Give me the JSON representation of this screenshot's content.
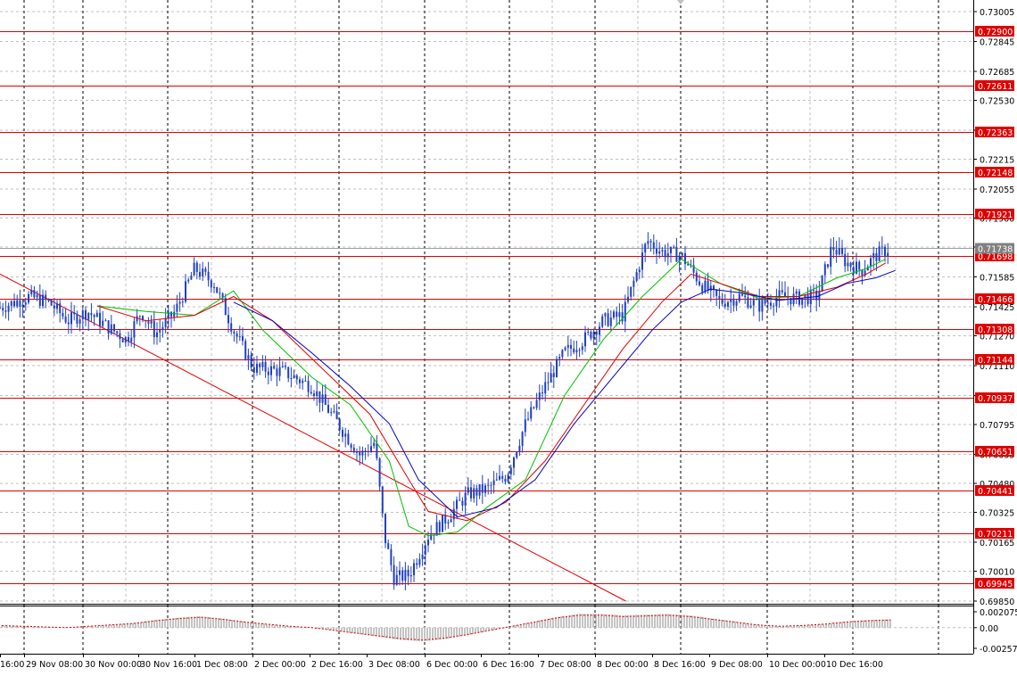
{
  "chart_data": {
    "type": "candlestick",
    "main": {
      "ylim": [
        0.6985,
        0.73005
      ],
      "price_scale_ticks": [
        "0.73005",
        "0.72845",
        "0.72685",
        "0.72530",
        "0.72370",
        "0.72215",
        "0.72055",
        "0.71900",
        "0.71745",
        "0.71585",
        "0.71425",
        "0.71270",
        "0.71110",
        "0.70950",
        "0.70795",
        "0.70635",
        "0.70480",
        "0.70325",
        "0.70165",
        "0.70010",
        "0.69850"
      ],
      "horizontal_levels": [
        0.729,
        0.72611,
        0.72363,
        0.72148,
        0.71921,
        0.71698,
        0.71466,
        0.71308,
        0.71144,
        0.70937,
        0.70651,
        0.70441,
        0.70211,
        0.69945
      ],
      "horizontal_level_labels": [
        "0.72900",
        "0.72611",
        "0.72363",
        "0.72148",
        "0.71921",
        "0.71698",
        "0.71466",
        "0.71308",
        "0.71144",
        "0.70937",
        "0.70651",
        "0.70441",
        "0.70211",
        "0.69945"
      ],
      "current_price_label": "0.71738",
      "current_price": 0.71738,
      "trendline": {
        "from": [
          0,
          0.716
        ],
        "to": [
          0.643,
          0.6985
        ]
      },
      "price_path": [
        [
          0.0,
          0.7142
        ],
        [
          0.03,
          0.7148
        ],
        [
          0.05,
          0.7145
        ],
        [
          0.07,
          0.7135
        ],
        [
          0.09,
          0.714
        ],
        [
          0.11,
          0.7132
        ],
        [
          0.13,
          0.7125
        ],
        [
          0.145,
          0.714
        ],
        [
          0.16,
          0.7128
        ],
        [
          0.18,
          0.714
        ],
        [
          0.2,
          0.7163
        ],
        [
          0.22,
          0.7155
        ],
        [
          0.24,
          0.713
        ],
        [
          0.26,
          0.711
        ],
        [
          0.29,
          0.7108
        ],
        [
          0.32,
          0.71
        ],
        [
          0.35,
          0.7078
        ],
        [
          0.37,
          0.7063
        ],
        [
          0.385,
          0.707
        ],
        [
          0.395,
          0.702
        ],
        [
          0.405,
          0.6997
        ],
        [
          0.42,
          0.6999
        ],
        [
          0.44,
          0.702
        ],
        [
          0.46,
          0.703
        ],
        [
          0.48,
          0.7042
        ],
        [
          0.5,
          0.7045
        ],
        [
          0.52,
          0.7052
        ],
        [
          0.54,
          0.708
        ],
        [
          0.56,
          0.71
        ],
        [
          0.58,
          0.7118
        ],
        [
          0.6,
          0.7125
        ],
        [
          0.62,
          0.7135
        ],
        [
          0.64,
          0.7138
        ],
        [
          0.655,
          0.7162
        ],
        [
          0.665,
          0.7178
        ],
        [
          0.68,
          0.7172
        ],
        [
          0.7,
          0.717
        ],
        [
          0.72,
          0.7155
        ],
        [
          0.74,
          0.7145
        ],
        [
          0.76,
          0.7148
        ],
        [
          0.78,
          0.7143
        ],
        [
          0.8,
          0.7148
        ],
        [
          0.82,
          0.7147
        ],
        [
          0.84,
          0.7148
        ],
        [
          0.855,
          0.7175
        ],
        [
          0.87,
          0.7166
        ],
        [
          0.885,
          0.7162
        ],
        [
          0.9,
          0.717
        ],
        [
          0.915,
          0.7174
        ]
      ],
      "moving_averages": [
        {
          "color": "#00c000",
          "period": 1,
          "path": [
            [
              0.1,
              0.7143
            ],
            [
              0.15,
              0.714
            ],
            [
              0.2,
              0.7138
            ],
            [
              0.24,
              0.7151
            ],
            [
              0.27,
              0.713
            ],
            [
              0.32,
              0.7105
            ],
            [
              0.36,
              0.709
            ],
            [
              0.4,
              0.706
            ],
            [
              0.42,
              0.7025
            ],
            [
              0.44,
              0.702
            ],
            [
              0.47,
              0.7022
            ],
            [
              0.5,
              0.7035
            ],
            [
              0.54,
              0.705
            ],
            [
              0.58,
              0.7095
            ],
            [
              0.62,
              0.7125
            ],
            [
              0.66,
              0.7148
            ],
            [
              0.7,
              0.7168
            ],
            [
              0.74,
              0.7155
            ],
            [
              0.78,
              0.7147
            ],
            [
              0.82,
              0.7148
            ],
            [
              0.86,
              0.7158
            ],
            [
              0.89,
              0.7163
            ],
            [
              0.91,
              0.7168
            ]
          ]
        },
        {
          "color": "#e00000",
          "period": 2,
          "path": [
            [
              0.1,
              0.7143
            ],
            [
              0.15,
              0.7135
            ],
            [
              0.2,
              0.7138
            ],
            [
              0.24,
              0.7148
            ],
            [
              0.28,
              0.7135
            ],
            [
              0.33,
              0.711
            ],
            [
              0.38,
              0.7085
            ],
            [
              0.42,
              0.705
            ],
            [
              0.44,
              0.7033
            ],
            [
              0.48,
              0.7028
            ],
            [
              0.52,
              0.7038
            ],
            [
              0.56,
              0.706
            ],
            [
              0.6,
              0.709
            ],
            [
              0.64,
              0.712
            ],
            [
              0.68,
              0.7145
            ],
            [
              0.71,
              0.716
            ],
            [
              0.74,
              0.7155
            ],
            [
              0.78,
              0.7148
            ],
            [
              0.82,
              0.7148
            ],
            [
              0.86,
              0.7153
            ],
            [
              0.89,
              0.716
            ],
            [
              0.91,
              0.7166
            ]
          ]
        },
        {
          "color": "#0000c0",
          "period": 3,
          "path": [
            [
              0.24,
              0.7145
            ],
            [
              0.28,
              0.7135
            ],
            [
              0.32,
              0.7118
            ],
            [
              0.36,
              0.71
            ],
            [
              0.4,
              0.708
            ],
            [
              0.43,
              0.705
            ],
            [
              0.47,
              0.703
            ],
            [
              0.51,
              0.7035
            ],
            [
              0.55,
              0.705
            ],
            [
              0.59,
              0.708
            ],
            [
              0.63,
              0.7105
            ],
            [
              0.67,
              0.713
            ],
            [
              0.7,
              0.7145
            ],
            [
              0.73,
              0.7152
            ],
            [
              0.76,
              0.715
            ],
            [
              0.8,
              0.7146
            ],
            [
              0.84,
              0.7148
            ],
            [
              0.87,
              0.7155
            ],
            [
              0.9,
              0.7158
            ],
            [
              0.92,
              0.7162
            ]
          ]
        }
      ]
    },
    "oscillator": {
      "ylim": [
        -0.00271,
        0.00207
      ],
      "ticks": [
        "0.002075",
        "0.00",
        "-0.002571"
      ],
      "histogram": [
        0.0003,
        0.0002,
        0.0001,
        0.0,
        0.0002,
        0.0004,
        0.0006,
        0.001,
        0.0013,
        0.0015,
        0.0012,
        0.0008,
        0.0005,
        0.0002,
        0.0,
        -0.0004,
        -0.0008,
        -0.0012,
        -0.0016,
        -0.0018,
        -0.0015,
        -0.001,
        -0.0004,
        0.0002,
        0.0008,
        0.0014,
        0.0018,
        0.0018,
        0.0016,
        0.0017,
        0.0018,
        0.0016,
        0.0012,
        0.0008,
        0.0004,
        0.0002,
        0.0003,
        0.0005,
        0.0008,
        0.001,
        0.0011
      ],
      "signal_color": "#e00000"
    },
    "x_axis": {
      "ticks": [
        "16:00",
        "29 Nov 08:00",
        "30 Nov 00:00",
        "30 Nov 16:00",
        "1 Dec 08:00",
        "2 Dec 00:00",
        "2 Dec 16:00",
        "3 Dec 08:00",
        "6 Dec 00:00",
        "6 Dec 16:00",
        "7 Dec 08:00",
        "8 Dec 00:00",
        "8 Dec 16:00",
        "9 Dec 08:00",
        "10 Dec 00:00",
        "10 Dec 16:00"
      ]
    },
    "colors": {
      "background": "#ffffff",
      "grid": "#c0c0c0",
      "levels": "#e00000",
      "candles": "#2040c0",
      "label_bg": "#e00000",
      "label_fg": "#ffffff",
      "text": "#000000"
    }
  }
}
